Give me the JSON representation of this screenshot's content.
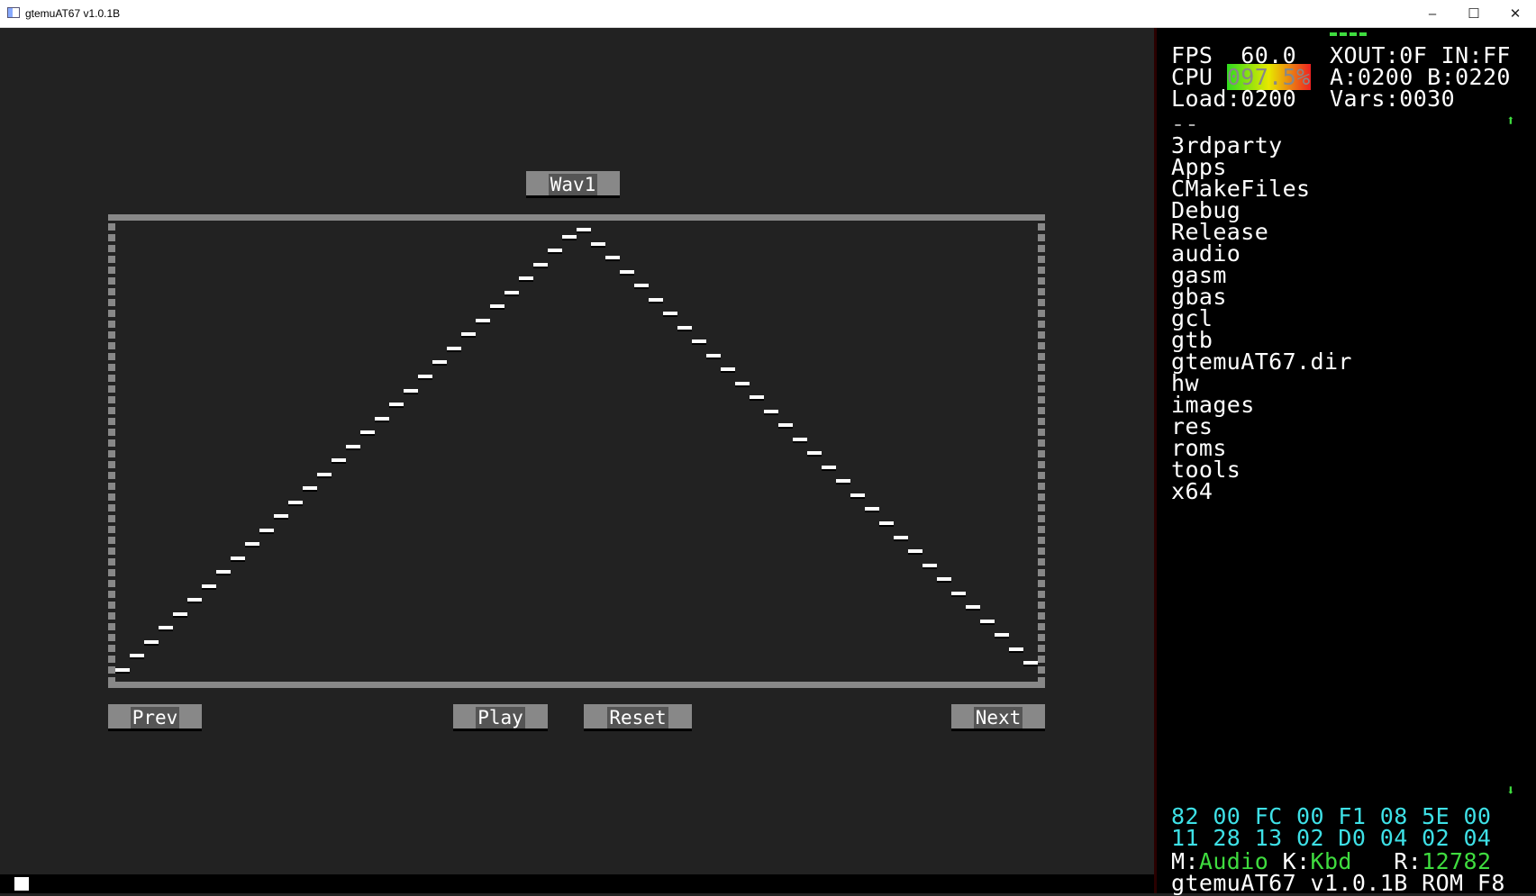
{
  "window": {
    "title": "gtemuAT67 v1.0.1B",
    "controls": [
      "minimize",
      "maximize",
      "close"
    ]
  },
  "editor": {
    "waveform_label": "Wav1",
    "buttons": {
      "prev": "Prev",
      "play": "Play",
      "reset": "Reset",
      "next": "Next"
    },
    "samples": [
      0,
      2,
      4,
      6,
      8,
      10,
      12,
      14,
      16,
      18,
      20,
      22,
      24,
      26,
      28,
      30,
      32,
      34,
      36,
      38,
      40,
      42,
      44,
      46,
      48,
      50,
      52,
      54,
      56,
      58,
      60,
      62,
      63,
      61,
      59,
      57,
      55,
      53,
      51,
      49,
      47,
      45,
      43,
      41,
      39,
      37,
      35,
      33,
      31,
      29,
      27,
      25,
      23,
      21,
      19,
      17,
      15,
      13,
      11,
      9,
      7,
      5,
      3,
      1
    ],
    "sample_max": 63
  },
  "status": {
    "fps_label": "FPS",
    "fps": "60.0",
    "xout": "XOUT:0F",
    "in": "IN:FF",
    "cpu_label": "CPU",
    "cpu": "097.5%",
    "a": "A:0200",
    "b": "B:0220",
    "load": "Load:0200",
    "vars": "Vars:0030"
  },
  "browser": {
    "items": [
      "--",
      "3rdparty",
      "Apps",
      "CMakeFiles",
      "Debug",
      "Release",
      "audio",
      "gasm",
      "gbas",
      "gcl",
      "gtb",
      "gtemuAT67.dir",
      "hw",
      "images",
      "res",
      "roms",
      "tools",
      "x64"
    ]
  },
  "hex": {
    "row1": "82 00 FC 00 F1 08 5E 00",
    "row2": "11 28 13 02 D0 04 02 04"
  },
  "footer": {
    "m_label": "M:",
    "mode": "Audio",
    "k_label": "K:",
    "kbd": "Kbd",
    "r_label": "R:",
    "r": "12782",
    "version": "gtemuAT67 v1.0.1B ROM F8"
  },
  "colors": {
    "cyan": "#3ee0e6",
    "green": "#3fdc3f",
    "panel": "#222222"
  }
}
